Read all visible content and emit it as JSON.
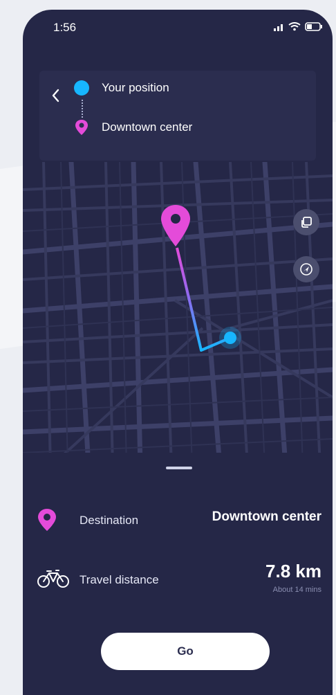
{
  "status": {
    "time": "1:56"
  },
  "route": {
    "origin": "Your position",
    "destination": "Downtown center"
  },
  "sheet": {
    "destination_label": "Destination",
    "destination_value": "Downtown center",
    "distance_label": "Travel distance",
    "distance_value": "7.8 km",
    "eta": "About 14 mins",
    "go_label": "Go"
  },
  "colors": {
    "background": "#252747",
    "accent_origin": "#17b6ff",
    "accent_destination": "#e44bd9",
    "button": "#ffffff"
  },
  "icons": {
    "back": "chevron-left-icon",
    "origin": "location-dot-icon",
    "destination": "map-pin-icon",
    "layers": "layers-icon",
    "locate": "navigation-arrow-icon",
    "bike": "bicycle-icon"
  }
}
